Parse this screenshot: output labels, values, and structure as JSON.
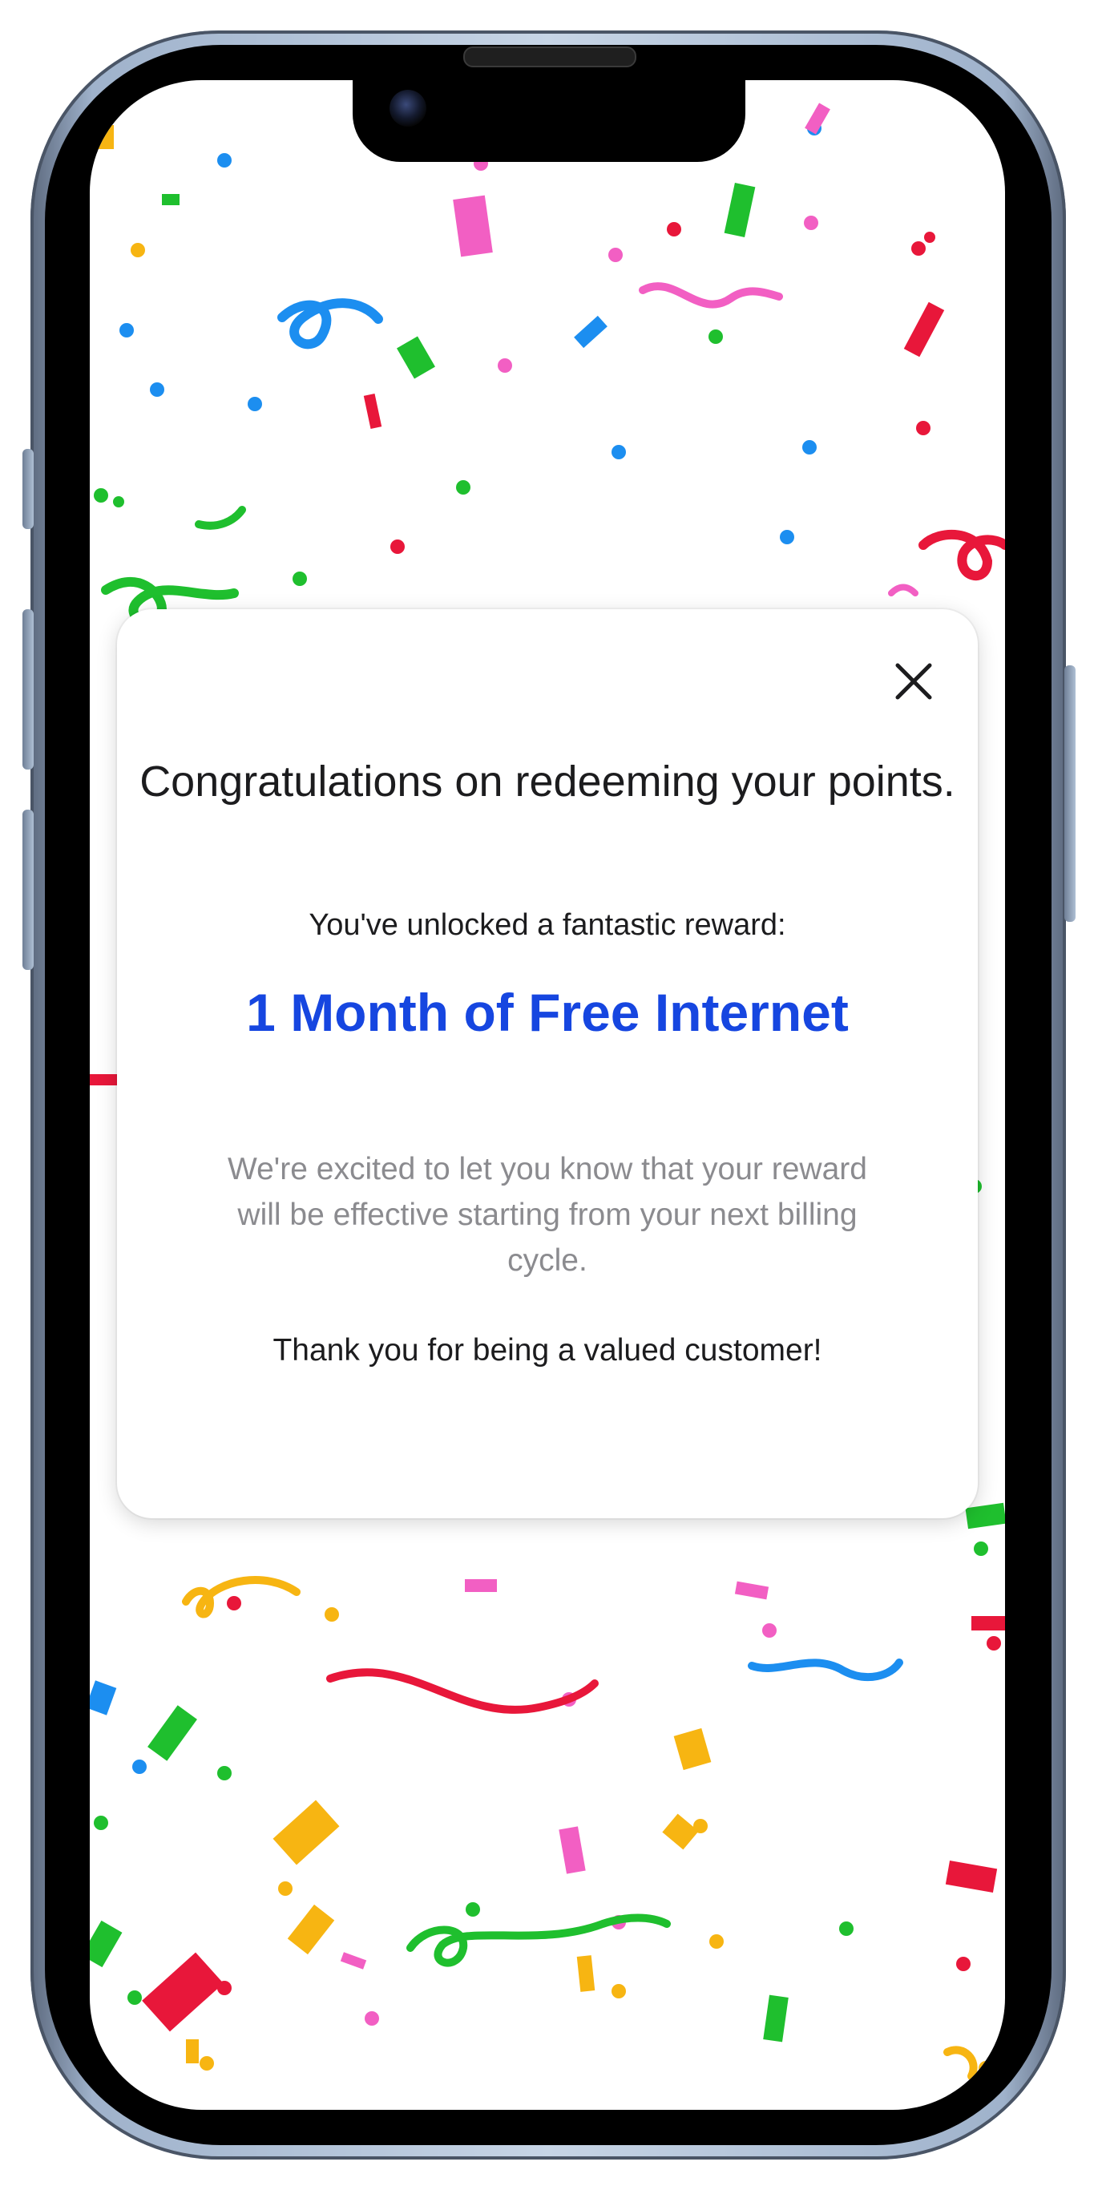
{
  "dialog": {
    "title": "Congratulations on redeeming your points.",
    "subtitle": "You've unlocked a fantastic reward:",
    "reward": "1 Month of Free Internet",
    "description": "We're excited to let you know that your reward will be effective starting from your next billing cycle.",
    "thanks": "Thank you for being a valued customer!",
    "close_icon": "close-icon"
  },
  "colors": {
    "accent": "#1646e0",
    "muted_text": "#8b8b8f",
    "confetti": [
      "#e8173a",
      "#1fbf2e",
      "#f7b512",
      "#1c8ef0",
      "#f25fc3"
    ]
  }
}
